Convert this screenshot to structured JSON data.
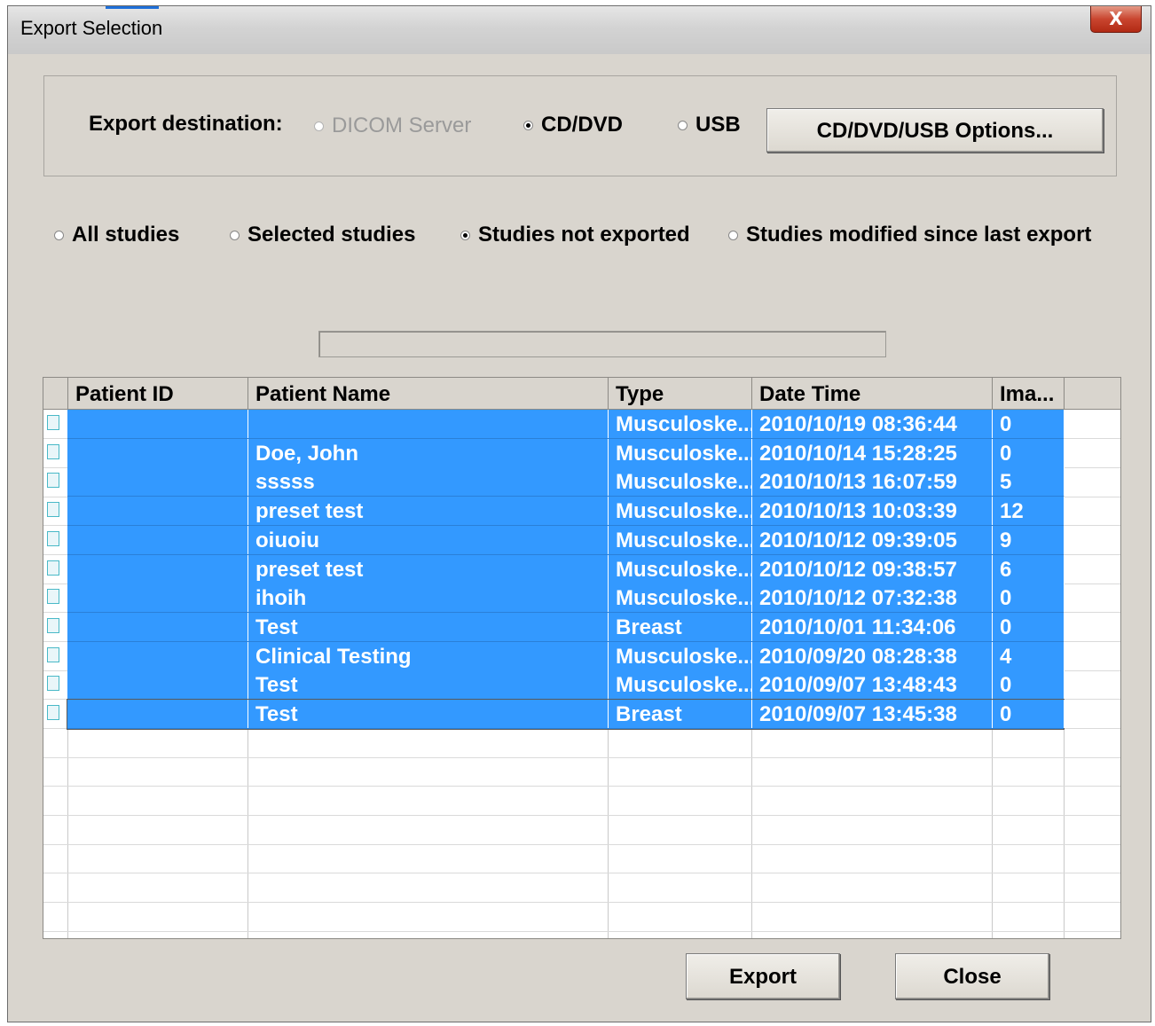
{
  "window": {
    "title": "Export Selection",
    "close_glyph": "X"
  },
  "destination": {
    "label": "Export destination:",
    "options": [
      {
        "label": "DICOM Server",
        "checked": false,
        "disabled": true
      },
      {
        "label": "CD/DVD",
        "checked": true,
        "disabled": false
      },
      {
        "label": "USB",
        "checked": false,
        "disabled": false
      }
    ],
    "options_button": "CD/DVD/USB Options..."
  },
  "scope": {
    "options": [
      {
        "label": "All studies",
        "checked": false
      },
      {
        "label": "Selected studies",
        "checked": false
      },
      {
        "label": "Studies not exported",
        "checked": true
      },
      {
        "label": "Studies modified since last export",
        "checked": false
      }
    ]
  },
  "table": {
    "columns": [
      "Patient ID",
      "Patient Name",
      "Type",
      "Date Time",
      "Ima..."
    ],
    "rows": [
      {
        "patient_id": "",
        "patient_name": "",
        "type": "Musculoske...",
        "date_time": "2010/10/19 08:36:44",
        "images": "0"
      },
      {
        "patient_id": "",
        "patient_name": "Doe, John",
        "type": "Musculoske...",
        "date_time": "2010/10/14 15:28:25",
        "images": "0"
      },
      {
        "patient_id": "",
        "patient_name": "sssss",
        "type": "Musculoske...",
        "date_time": "2010/10/13 16:07:59",
        "images": "5"
      },
      {
        "patient_id": "",
        "patient_name": "preset test",
        "type": "Musculoske...",
        "date_time": "2010/10/13 10:03:39",
        "images": "12"
      },
      {
        "patient_id": "",
        "patient_name": "oiuoiu",
        "type": "Musculoske...",
        "date_time": "2010/10/12 09:39:05",
        "images": "9"
      },
      {
        "patient_id": "",
        "patient_name": "preset test",
        "type": "Musculoske...",
        "date_time": "2010/10/12 09:38:57",
        "images": "6"
      },
      {
        "patient_id": "",
        "patient_name": "ihoih",
        "type": "Musculoske...",
        "date_time": "2010/10/12 07:32:38",
        "images": "0"
      },
      {
        "patient_id": "",
        "patient_name": "Test",
        "type": "Breast",
        "date_time": "2010/10/01 11:34:06",
        "images": "0"
      },
      {
        "patient_id": "",
        "patient_name": "Clinical Testing",
        "type": "Musculoske...",
        "date_time": "2010/09/20 08:28:38",
        "images": "4"
      },
      {
        "patient_id": "",
        "patient_name": "Test",
        "type": "Musculoske...",
        "date_time": "2010/09/07 13:48:43",
        "images": "0"
      },
      {
        "patient_id": "",
        "patient_name": "Test",
        "type": "Breast",
        "date_time": "2010/09/07 13:45:38",
        "images": "0"
      }
    ]
  },
  "buttons": {
    "export": "Export",
    "close": "Close"
  },
  "colors": {
    "selection": "#3399ff",
    "dialog_bg": "#d9d5ce",
    "close_button": "#c9452f"
  }
}
